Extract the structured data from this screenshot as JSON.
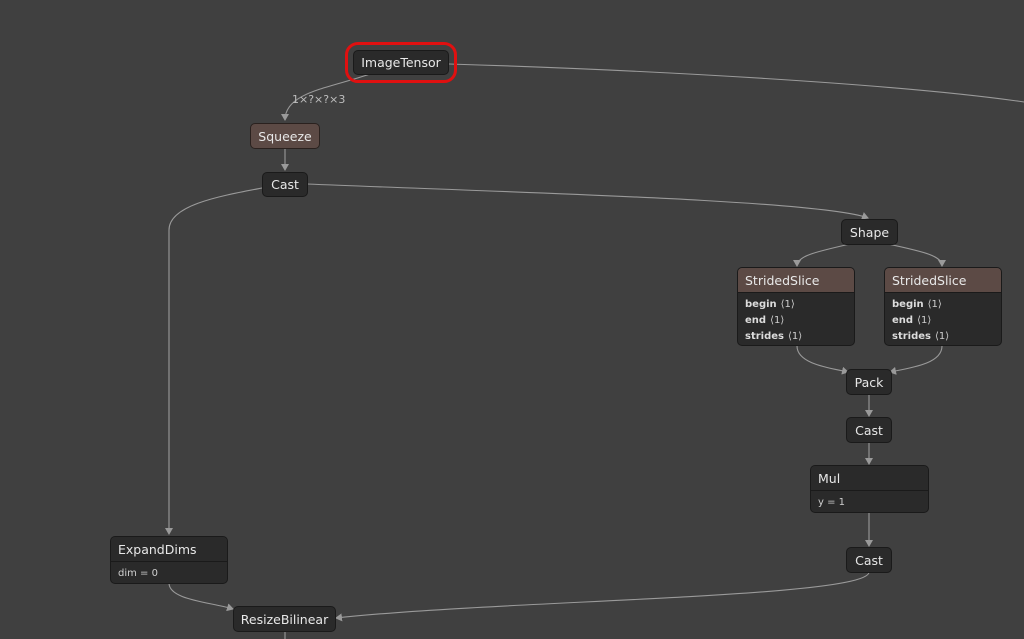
{
  "graph": {
    "nodes": {
      "image_tensor": {
        "label": "ImageTensor"
      },
      "squeeze": {
        "label": "Squeeze"
      },
      "cast_top": {
        "label": "Cast"
      },
      "shape": {
        "label": "Shape"
      },
      "strided_slice_1": {
        "label": "StridedSlice",
        "attrs": [
          {
            "name": "begin",
            "value": "⟨1⟩"
          },
          {
            "name": "end",
            "value": "⟨1⟩"
          },
          {
            "name": "strides",
            "value": "⟨1⟩"
          }
        ]
      },
      "strided_slice_2": {
        "label": "StridedSlice",
        "attrs": [
          {
            "name": "begin",
            "value": "⟨1⟩"
          },
          {
            "name": "end",
            "value": "⟨1⟩"
          },
          {
            "name": "strides",
            "value": "⟨1⟩"
          }
        ]
      },
      "pack": {
        "label": "Pack"
      },
      "cast_mid": {
        "label": "Cast"
      },
      "mul": {
        "label": "Mul",
        "attr_text": "y = 1"
      },
      "cast_bottom": {
        "label": "Cast"
      },
      "expand_dims": {
        "label": "ExpandDims",
        "attr_text": "dim = 0"
      },
      "resize_bilinear": {
        "label": "ResizeBilinear"
      }
    },
    "edge_labels": {
      "image_to_squeeze": "1×?×?×3"
    },
    "selected_node": "ImageTensor"
  },
  "colors": {
    "background": "#404040",
    "node": "#2a2a2a",
    "node_accent": "#5c4a45",
    "edge": "#9a9a9a",
    "selection": "#e01010"
  }
}
